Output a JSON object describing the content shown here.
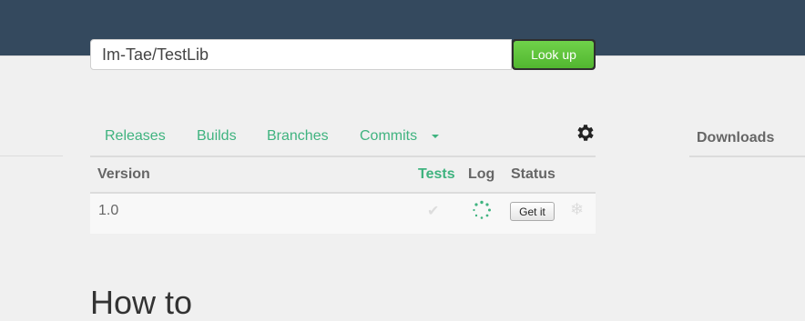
{
  "search": {
    "value": "Im-Tae/TestLib",
    "button_label": "Look up"
  },
  "tabs": [
    {
      "label": "Releases"
    },
    {
      "label": "Builds"
    },
    {
      "label": "Branches"
    },
    {
      "label": "Commits"
    }
  ],
  "icons": {
    "settings": "gear-icon",
    "caret": "caret-down-icon",
    "tests_status": "check-icon",
    "log_status": "spinner-icon",
    "extra_status": "snowflake-icon"
  },
  "downloads": {
    "label": "Downloads"
  },
  "table": {
    "headers": {
      "version": "Version",
      "tests": "Tests",
      "log": "Log",
      "status": "Status"
    },
    "rows": [
      {
        "version": "1.0",
        "action_label": "Get it"
      }
    ]
  },
  "section": {
    "heading": "How to"
  },
  "colors": {
    "header_bar": "#34495e",
    "accent": "#3fb37f",
    "button_green": "#5cc13a",
    "background": "#f0f0f0"
  }
}
